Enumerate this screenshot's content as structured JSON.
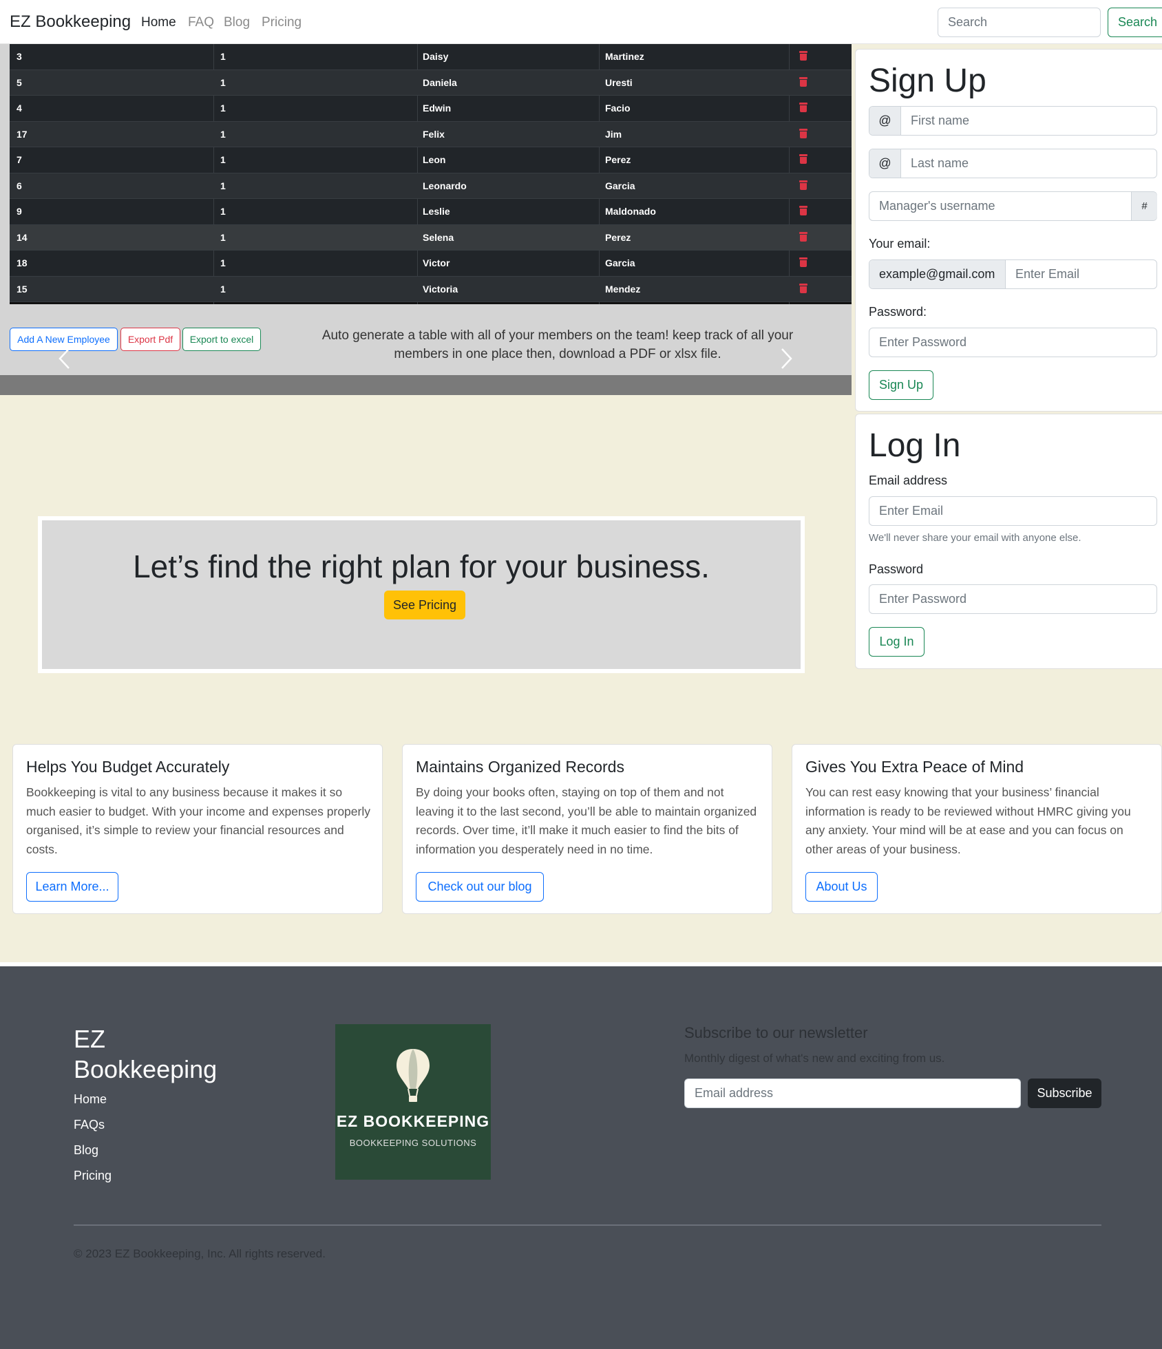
{
  "navbar": {
    "brand": "EZ Bookkeeping",
    "links": [
      "Home",
      "FAQ",
      "Blog",
      "Pricing"
    ],
    "search_placeholder": "Search",
    "search_button": "Search"
  },
  "employees": {
    "rows": [
      {
        "id": "3",
        "manager": "1",
        "first": "Daisy",
        "last": "Martinez"
      },
      {
        "id": "5",
        "manager": "1",
        "first": "Daniela",
        "last": "Uresti"
      },
      {
        "id": "4",
        "manager": "1",
        "first": "Edwin",
        "last": "Facio"
      },
      {
        "id": "17",
        "manager": "1",
        "first": "Felix",
        "last": "Jim"
      },
      {
        "id": "7",
        "manager": "1",
        "first": "Leon",
        "last": "Perez"
      },
      {
        "id": "6",
        "manager": "1",
        "first": "Leonardo",
        "last": "Garcia"
      },
      {
        "id": "9",
        "manager": "1",
        "first": "Leslie",
        "last": "Maldonado"
      },
      {
        "id": "14",
        "manager": "1",
        "first": "Selena",
        "last": "Perez"
      },
      {
        "id": "18",
        "manager": "1",
        "first": "Victor",
        "last": "Garcia"
      },
      {
        "id": "15",
        "manager": "1",
        "first": "Victoria",
        "last": "Mendez"
      }
    ],
    "add_button": "Add A New Employee",
    "pdf_button": "Export Pdf",
    "excel_button": "Export to excel",
    "caption": "Auto generate a table with all of your members on the team! keep track of all your members in one place then, download a PDF or xlsx file."
  },
  "promo": {
    "title": "Let’s find the right plan for your business.",
    "button": "See Pricing"
  },
  "signup": {
    "title": "Sign Up",
    "at_addon": "@",
    "first_name_placeholder": "First name",
    "last_name_placeholder": "Last name",
    "manager_placeholder": "Manager's username",
    "hash_addon": "#",
    "email_label": "Your email:",
    "email_addon": "example@gmail.com",
    "email_placeholder": "Enter Email",
    "password_label": "Password:",
    "password_placeholder": "Enter Password",
    "button": "Sign Up"
  },
  "login": {
    "title": "Log In",
    "email_label": "Email address",
    "email_placeholder": "Enter Email",
    "email_help": "We'll never share your email with anyone else.",
    "password_label": "Password",
    "password_placeholder": "Enter Password",
    "button": "Log In"
  },
  "cards": [
    {
      "title": "Helps You Budget Accurately",
      "text": "Bookkeeping is vital to any business because it makes it so much easier to budget. With your income and expenses properly organised, it’s simple to review your financial resources and costs.",
      "button": "Learn More..."
    },
    {
      "title": "Maintains Organized Records",
      "text": "By doing your books often, staying on top of them and not leaving it to the last second, you’ll be able to maintain organized records. Over time, it’ll make it much easier to find the bits of information you desperately need in no time.",
      "button": "Check out our blog"
    },
    {
      "title": "Gives You Extra Peace of Mind",
      "text": "You can rest easy knowing that your business’ financial information is ready to be reviewed without HMRC giving you any anxiety. Your mind will be at ease and you can focus on other areas of your business.",
      "button": "About Us"
    }
  ],
  "footer": {
    "brand": "EZ Bookkeeping",
    "links": [
      "Home",
      "FAQs",
      "Blog",
      "Pricing"
    ],
    "logo_title": "EZ BOOKKEEPING",
    "logo_subtitle": "BOOKKEEPING SOLUTIONS",
    "newsletter_title": "Subscribe to our newsletter",
    "newsletter_sub": "Monthly digest of what's new and exciting from us.",
    "newsletter_placeholder": "Email address",
    "subscribe_button": "Subscribe",
    "copyright": "© 2023 EZ Bookkeeping, Inc. All rights reserved."
  },
  "colors": {
    "page_bg": "#f2efdc",
    "footer_bg": "#4a4f57",
    "table_bg": "#212529",
    "delete_red": "#dc3545",
    "success_green": "#198754",
    "primary_blue": "#0d6efd",
    "warning_yellow": "#ffc107",
    "logo_green": "#2a4a37"
  },
  "icons": {
    "delete": "trash-icon",
    "carousel_prev": "chevron-left-icon",
    "carousel_next": "chevron-right-icon",
    "logo": "hot-air-balloon-icon"
  }
}
